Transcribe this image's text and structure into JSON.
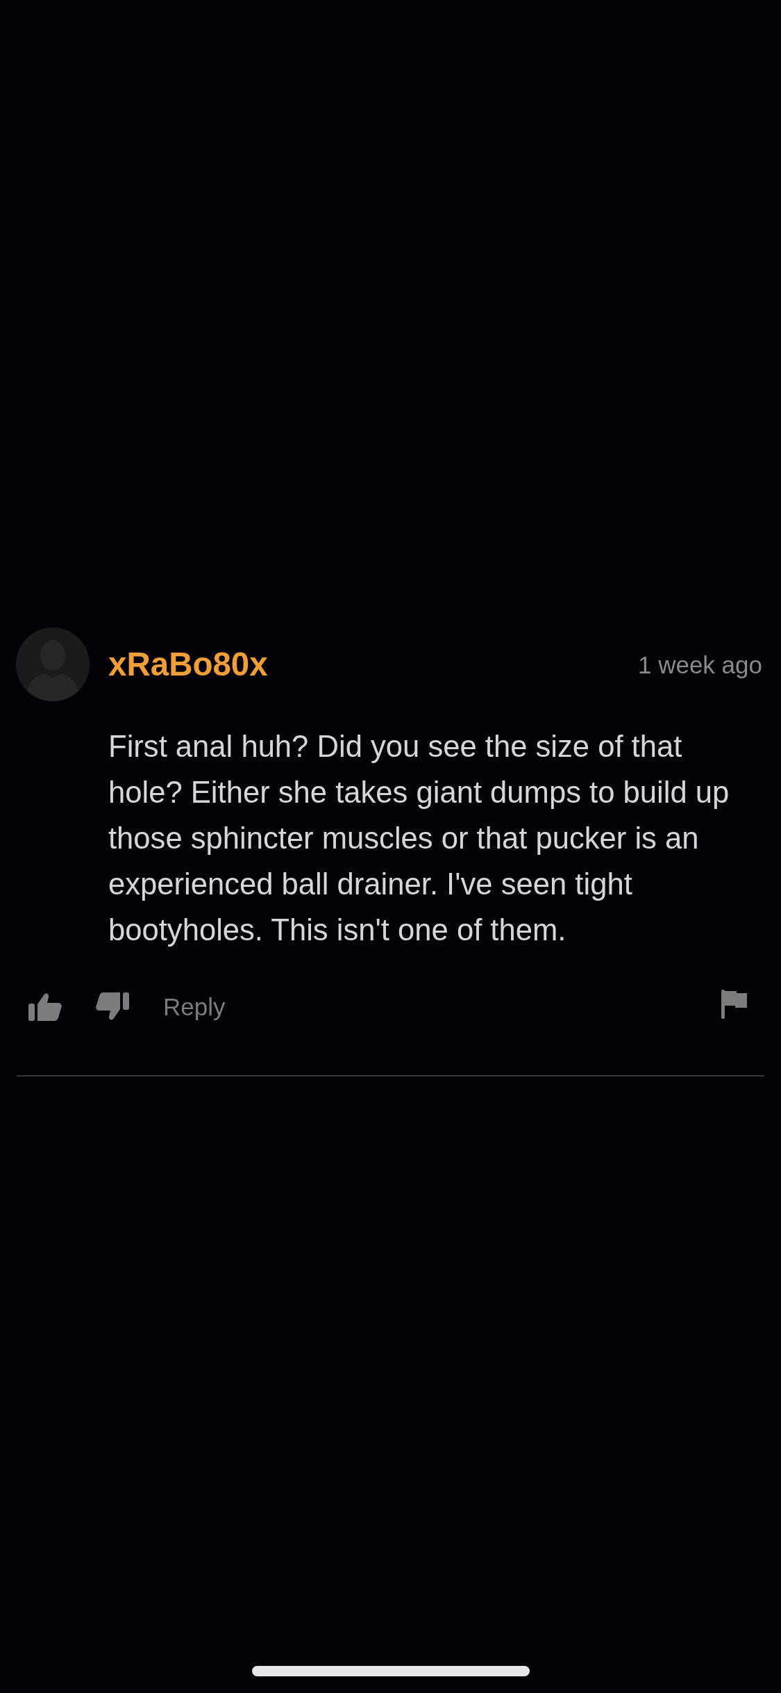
{
  "comment": {
    "author": "xRaBo80x",
    "timestamp": "1 week ago",
    "body": "First anal huh? Did you see the size of that hole? Either she takes giant dumps to build up those sphincter muscles or that pucker is an experienced ball drainer. I've seen tight bootyholes. This isn't one of them.",
    "reply_label": "Reply"
  }
}
